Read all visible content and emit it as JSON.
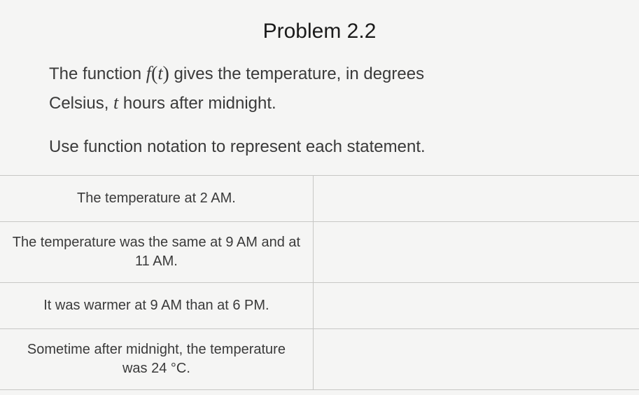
{
  "title": "Problem 2.2",
  "intro": {
    "line1_a": "The function ",
    "func_name": "f",
    "paren_open": "(",
    "func_arg": "t",
    "paren_close": ")",
    "line1_b": " gives the temperature, in degrees",
    "line2_a": "Celsius, ",
    "var_t": "t",
    "line2_b": " hours after midnight."
  },
  "instruction": "Use function notation to represent each statement.",
  "rows": [
    {
      "prompt": "The temperature at 2 AM.",
      "answer": ""
    },
    {
      "prompt": "The temperature was the same at 9 AM and at 11 AM.",
      "answer": ""
    },
    {
      "prompt": "It was warmer at 9 AM than at 6 PM.",
      "answer": ""
    },
    {
      "prompt_a": "Sometime after midnight, the temperature",
      "prompt_b": "was 24 °C.",
      "answer": ""
    }
  ]
}
